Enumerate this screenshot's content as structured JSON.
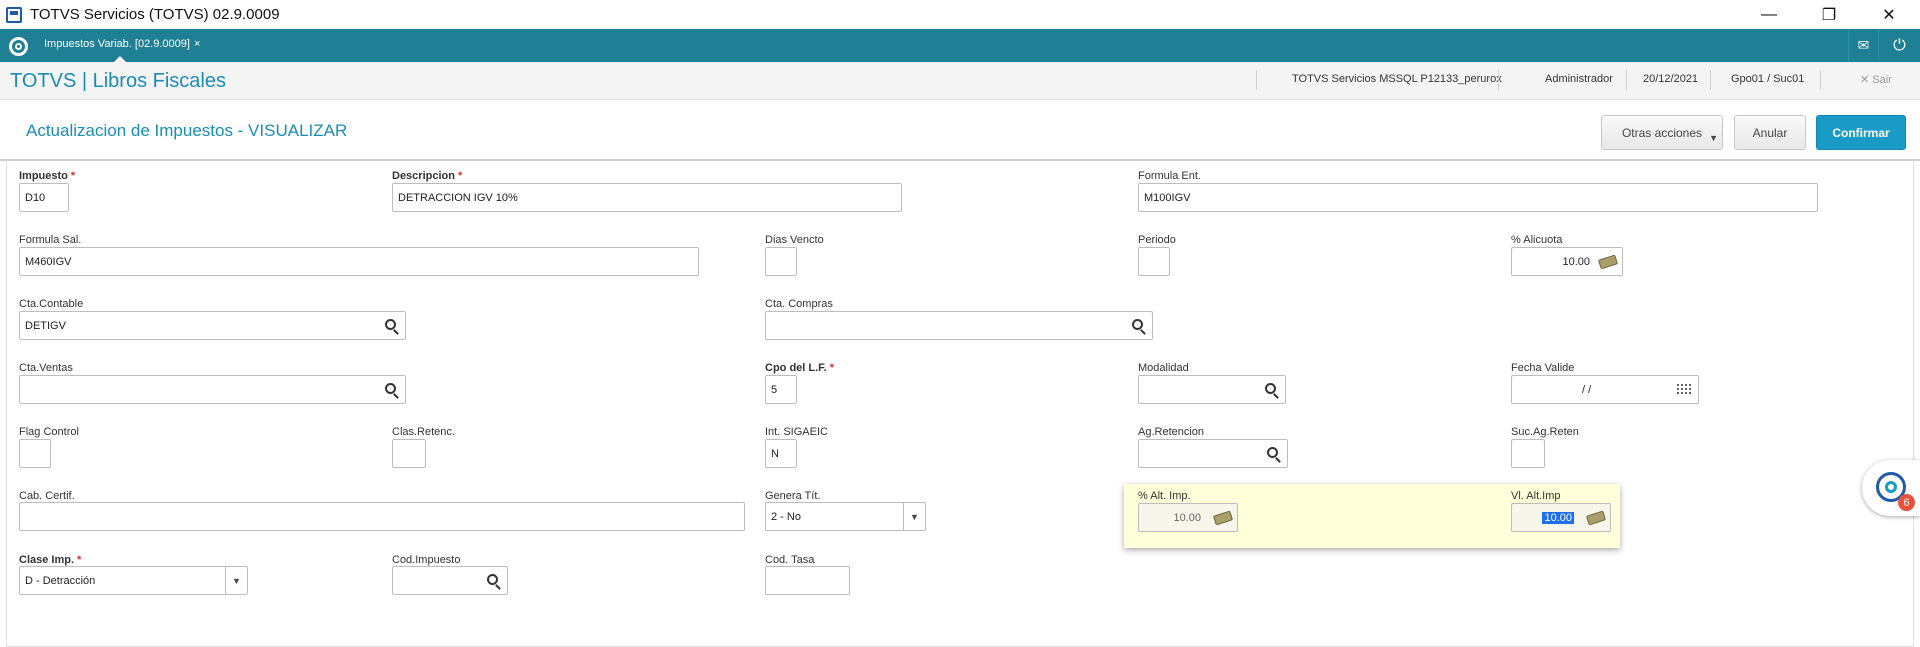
{
  "window": {
    "title": "TOTVS Servicios (TOTVS) 02.9.0009",
    "minimize": "—",
    "restore": "❐",
    "close": "✕"
  },
  "tabbar": {
    "tab_label": "Impuestos Variab. [02.9.0009]",
    "tab_close": "×",
    "mail_icon": "✉",
    "power_icon": "⏻"
  },
  "module": {
    "brand": "TOTVS | Libros Fiscales",
    "server": "TOTVS Servicios MSSQL P12133_perurox",
    "user": "Administrador",
    "date": "20/12/2021",
    "branch": "Gpo01 / Suc01",
    "exit": "✕ Sair"
  },
  "page": {
    "title": "Actualizacion de Impuestos - VISUALIZAR",
    "other_actions": "Otras acciones",
    "cancel": "Anular",
    "confirm": "Confirmar"
  },
  "form": {
    "impuesto": {
      "label": "Impuesto",
      "value": "D10"
    },
    "descripcion": {
      "label": "Descripcion",
      "value": "DETRACCION IGV 10%"
    },
    "formula_ent": {
      "label": "Formula Ent.",
      "value": "M100IGV"
    },
    "formula_sal": {
      "label": "Formula Sal.",
      "value": "M460IGV"
    },
    "dias_vencto": {
      "label": "Dias Vencto",
      "value": ""
    },
    "periodo": {
      "label": "Periodo",
      "value": ""
    },
    "alicuota": {
      "label": "% Alicuota",
      "value": "10.00"
    },
    "cta_contable": {
      "label": "Cta.Contable",
      "value": "DETIGV"
    },
    "cta_compras": {
      "label": "Cta. Compras",
      "value": ""
    },
    "cta_ventas": {
      "label": "Cta.Ventas",
      "value": ""
    },
    "cpo_lf": {
      "label": "Cpo del L.F.",
      "value": "5"
    },
    "modalidad": {
      "label": "Modalidad",
      "value": ""
    },
    "fecha_valide": {
      "label": "Fecha Valide",
      "value": "/ /"
    },
    "flag_control": {
      "label": "Flag Control",
      "value": ""
    },
    "clas_retenc": {
      "label": "Clas.Retenc.",
      "value": ""
    },
    "int_sigaeic": {
      "label": "Int. SIGAEIC",
      "value": "N"
    },
    "ag_retencion": {
      "label": "Ag.Retencion",
      "value": ""
    },
    "suc_ag_reten": {
      "label": "Suc.Ag.Reten",
      "value": ""
    },
    "cab_certif": {
      "label": "Cab. Certif.",
      "value": ""
    },
    "genera_tit": {
      "label": "Genera Tít.",
      "value": "2 - No"
    },
    "alt_imp": {
      "label": "% Alt. Imp.",
      "value": "10.00"
    },
    "vl_alt_imp": {
      "label": "Vl. Alt.Imp",
      "value": "10.00"
    },
    "clase_imp": {
      "label": "Clase Imp.",
      "value": "D - Detracción"
    },
    "cod_impuesto": {
      "label": "Cod.Impuesto",
      "value": ""
    },
    "cod_tasa": {
      "label": "Cod. Tasa",
      "value": ""
    }
  },
  "chat": {
    "badge": "6"
  }
}
